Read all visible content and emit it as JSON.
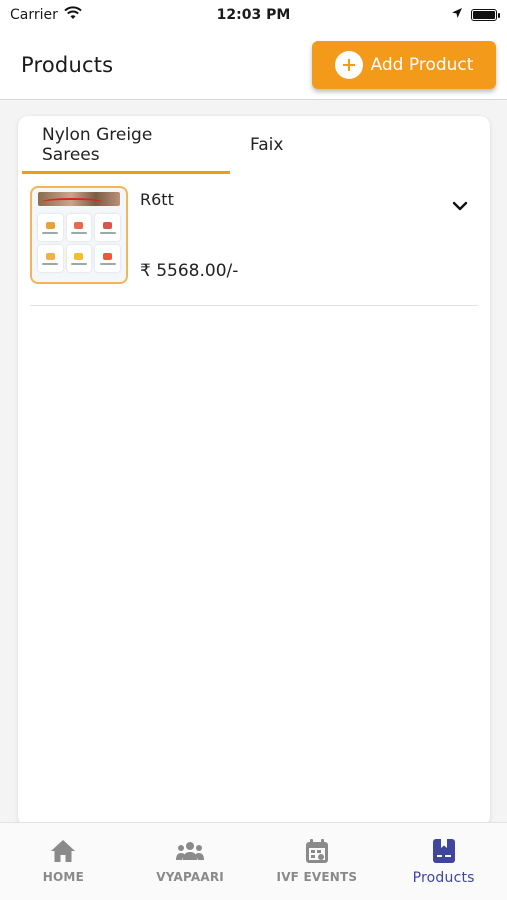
{
  "status_bar": {
    "carrier": "Carrier",
    "time": "12:03 PM"
  },
  "header": {
    "title": "Products",
    "add_button_label": "Add Product"
  },
  "tabs": [
    {
      "label": "Nylon Greige Sarees",
      "active": true
    },
    {
      "label": "Faix",
      "active": false
    }
  ],
  "products": [
    {
      "name": "R6tt",
      "price": "₹ 5568.00/-"
    }
  ],
  "bottom_nav": [
    {
      "label": "HOME",
      "icon": "home-icon",
      "active": false
    },
    {
      "label": "VYAPAARI",
      "icon": "people-icon",
      "active": false
    },
    {
      "label": "IVF EVENTS",
      "icon": "calendar-icon",
      "active": false
    },
    {
      "label": "Products",
      "icon": "products-bookmark-icon",
      "active": true
    }
  ],
  "colors": {
    "accent": "#f39a1b",
    "active_nav": "#3f469d",
    "inactive_nav": "#8a8a8a"
  }
}
